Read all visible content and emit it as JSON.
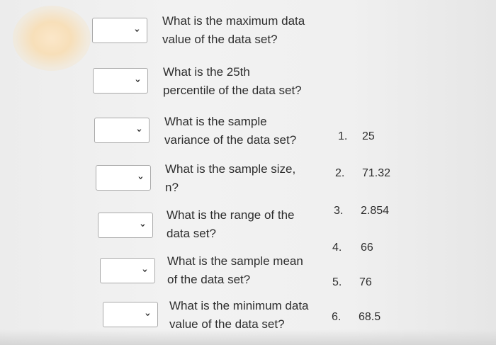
{
  "questions": [
    {
      "lines": [
        "What is the maximum data",
        "value of the data set?"
      ]
    },
    {
      "lines": [
        "What is the 25th",
        "percentile of the data set?"
      ]
    },
    {
      "lines": [
        "What is the sample",
        "variance of the data set?"
      ]
    },
    {
      "lines": [
        "What is the sample size,",
        "n?"
      ]
    },
    {
      "lines": [
        "What is the range of the",
        "data set?"
      ]
    },
    {
      "lines": [
        "What is the sample mean",
        "of the data set?"
      ]
    },
    {
      "lines": [
        "What is the minimum data",
        "value of the data set?"
      ]
    }
  ],
  "dropdown_icon": "chevron-down-icon",
  "dropdown_glyph": "›",
  "options": [
    {
      "number": "1.",
      "value": "25"
    },
    {
      "number": "2.",
      "value": "71.32"
    },
    {
      "number": "3.",
      "value": "2.854"
    },
    {
      "number": "4.",
      "value": "66"
    },
    {
      "number": "5.",
      "value": "76"
    },
    {
      "number": "6.",
      "value": "68.5"
    }
  ]
}
